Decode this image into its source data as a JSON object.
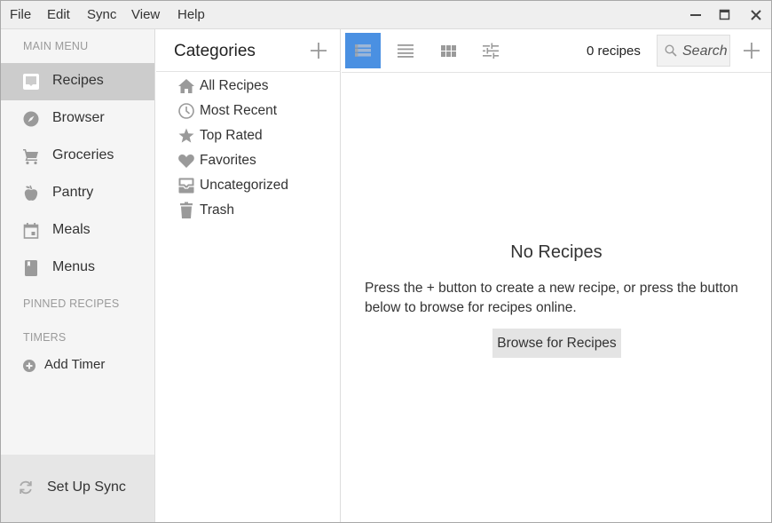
{
  "menubar": {
    "items": [
      "File",
      "Edit",
      "Sync",
      "View",
      "Help"
    ]
  },
  "window_controls": {
    "minimize": "minimize-icon",
    "maximize": "maximize-icon",
    "close": "close-icon"
  },
  "sidebar": {
    "main_menu_label": "MAIN MENU",
    "items": [
      {
        "label": "Recipes",
        "icon": "inbox-icon",
        "active": true
      },
      {
        "label": "Browser",
        "icon": "compass-icon",
        "active": false
      },
      {
        "label": "Groceries",
        "icon": "cart-icon",
        "active": false
      },
      {
        "label": "Pantry",
        "icon": "apple-icon",
        "active": false
      },
      {
        "label": "Meals",
        "icon": "calendar-icon",
        "active": false
      },
      {
        "label": "Menus",
        "icon": "book-icon",
        "active": false
      }
    ],
    "pinned_label": "PINNED RECIPES",
    "timers_label": "TIMERS",
    "add_timer_label": "Add Timer",
    "sync_label": "Set Up Sync"
  },
  "categories": {
    "title": "Categories",
    "items": [
      {
        "label": "All Recipes",
        "icon": "home-icon"
      },
      {
        "label": "Most Recent",
        "icon": "clock-icon"
      },
      {
        "label": "Top Rated",
        "icon": "star-icon"
      },
      {
        "label": "Favorites",
        "icon": "heart-icon"
      },
      {
        "label": "Uncategorized",
        "icon": "tray-icon"
      },
      {
        "label": "Trash",
        "icon": "trash-icon"
      }
    ]
  },
  "main": {
    "views": [
      "detail-list-view",
      "list-view",
      "grid-view",
      "filter-settings"
    ],
    "active_view": "detail-list-view",
    "recipe_count": "0 recipes",
    "search_placeholder": "Search",
    "empty_title": "No Recipes",
    "empty_text": "Press the + button to create a new recipe, or press the button below to browse for recipes online.",
    "browse_button": "Browse for Recipes"
  },
  "colors": {
    "accent": "#4a90e2",
    "sidebar_bg": "#f5f5f5",
    "active_item_bg": "#cccccc",
    "icon_gray": "#9a9a9a"
  }
}
